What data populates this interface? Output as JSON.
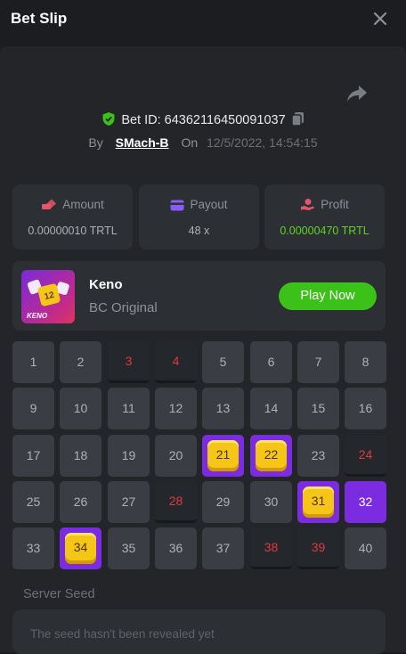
{
  "header": {
    "title": "Bet Slip"
  },
  "bet": {
    "id_label": "Bet ID: 64362116450091037",
    "by_label": "By",
    "user": "SMach-B",
    "on_label": "On",
    "date": "12/5/2022, 14:54:15"
  },
  "stats": [
    {
      "label": "Amount",
      "value": "0.00000010 TRTL",
      "icon": "coins-icon",
      "color": "#e8556a"
    },
    {
      "label": "Payout",
      "value": "48 x",
      "icon": "card-icon",
      "color": "#8a5cf6"
    },
    {
      "label": "Profit",
      "value": "0.00000470 TRTL",
      "icon": "hand-coins-icon",
      "color": "#e8556a",
      "value_color": "#5fd423"
    }
  ],
  "game": {
    "name": "Keno",
    "subtitle": "BC Original",
    "play_label": "Play Now",
    "thumb_text": "KENO",
    "thumb_tile": "12"
  },
  "keno": {
    "cells": [
      {
        "n": "1",
        "state": "normal"
      },
      {
        "n": "2",
        "state": "normal"
      },
      {
        "n": "3",
        "state": "miss"
      },
      {
        "n": "4",
        "state": "miss"
      },
      {
        "n": "5",
        "state": "normal"
      },
      {
        "n": "6",
        "state": "normal"
      },
      {
        "n": "7",
        "state": "normal"
      },
      {
        "n": "8",
        "state": "normal"
      },
      {
        "n": "9",
        "state": "normal"
      },
      {
        "n": "10",
        "state": "normal"
      },
      {
        "n": "11",
        "state": "normal"
      },
      {
        "n": "12",
        "state": "normal"
      },
      {
        "n": "13",
        "state": "normal"
      },
      {
        "n": "14",
        "state": "normal"
      },
      {
        "n": "15",
        "state": "normal"
      },
      {
        "n": "16",
        "state": "normal"
      },
      {
        "n": "17",
        "state": "normal"
      },
      {
        "n": "18",
        "state": "normal"
      },
      {
        "n": "19",
        "state": "normal"
      },
      {
        "n": "20",
        "state": "normal"
      },
      {
        "n": "21",
        "state": "hit"
      },
      {
        "n": "22",
        "state": "hit"
      },
      {
        "n": "23",
        "state": "normal"
      },
      {
        "n": "24",
        "state": "miss"
      },
      {
        "n": "25",
        "state": "normal"
      },
      {
        "n": "26",
        "state": "normal"
      },
      {
        "n": "27",
        "state": "normal"
      },
      {
        "n": "28",
        "state": "miss"
      },
      {
        "n": "29",
        "state": "normal"
      },
      {
        "n": "30",
        "state": "normal"
      },
      {
        "n": "31",
        "state": "hit"
      },
      {
        "n": "32",
        "state": "selected"
      },
      {
        "n": "33",
        "state": "normal"
      },
      {
        "n": "34",
        "state": "hit"
      },
      {
        "n": "35",
        "state": "normal"
      },
      {
        "n": "36",
        "state": "normal"
      },
      {
        "n": "37",
        "state": "normal"
      },
      {
        "n": "38",
        "state": "miss"
      },
      {
        "n": "39",
        "state": "miss"
      },
      {
        "n": "40",
        "state": "normal"
      }
    ]
  },
  "seed": {
    "label": "Server Seed",
    "text": "The seed hasn't been revealed yet"
  }
}
